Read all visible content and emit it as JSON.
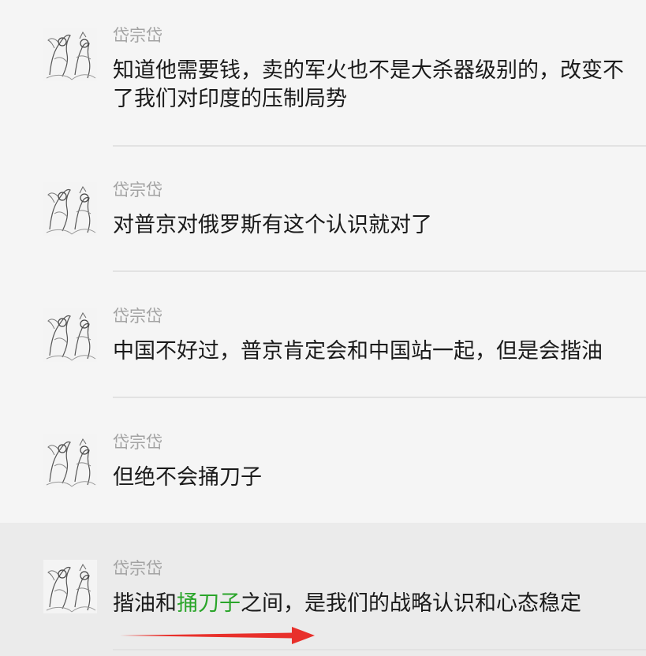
{
  "messages": [
    {
      "sender": "岱宗岱",
      "text": "知道他需要钱，卖的军火也不是大杀器级别的，改变不了我们对印度的压制局势"
    },
    {
      "sender": "岱宗岱",
      "text": "对普京对俄罗斯有这个认识就对了"
    },
    {
      "sender": "岱宗岱",
      "text": "中国不好过，普京肯定会和中国站一起，但是会揩油"
    },
    {
      "sender": "岱宗岱",
      "text": "但绝不会捅刀子"
    },
    {
      "sender": "岱宗岱",
      "text_before": "揩油和",
      "text_highlight": "捅刀子",
      "text_after": "之间，是我们的战略认识和心态稳定"
    }
  ],
  "colors": {
    "background": "#f5f5f5",
    "highlight_row": "#ebebeb",
    "sender": "#a3a3a3",
    "text": "#1a1a1a",
    "keyword_green": "#2aa52a",
    "arrow_red": "#e8302b"
  },
  "icons": {
    "avatar": "avatar-illustration-icon",
    "annotation": "red-arrow-icon"
  }
}
